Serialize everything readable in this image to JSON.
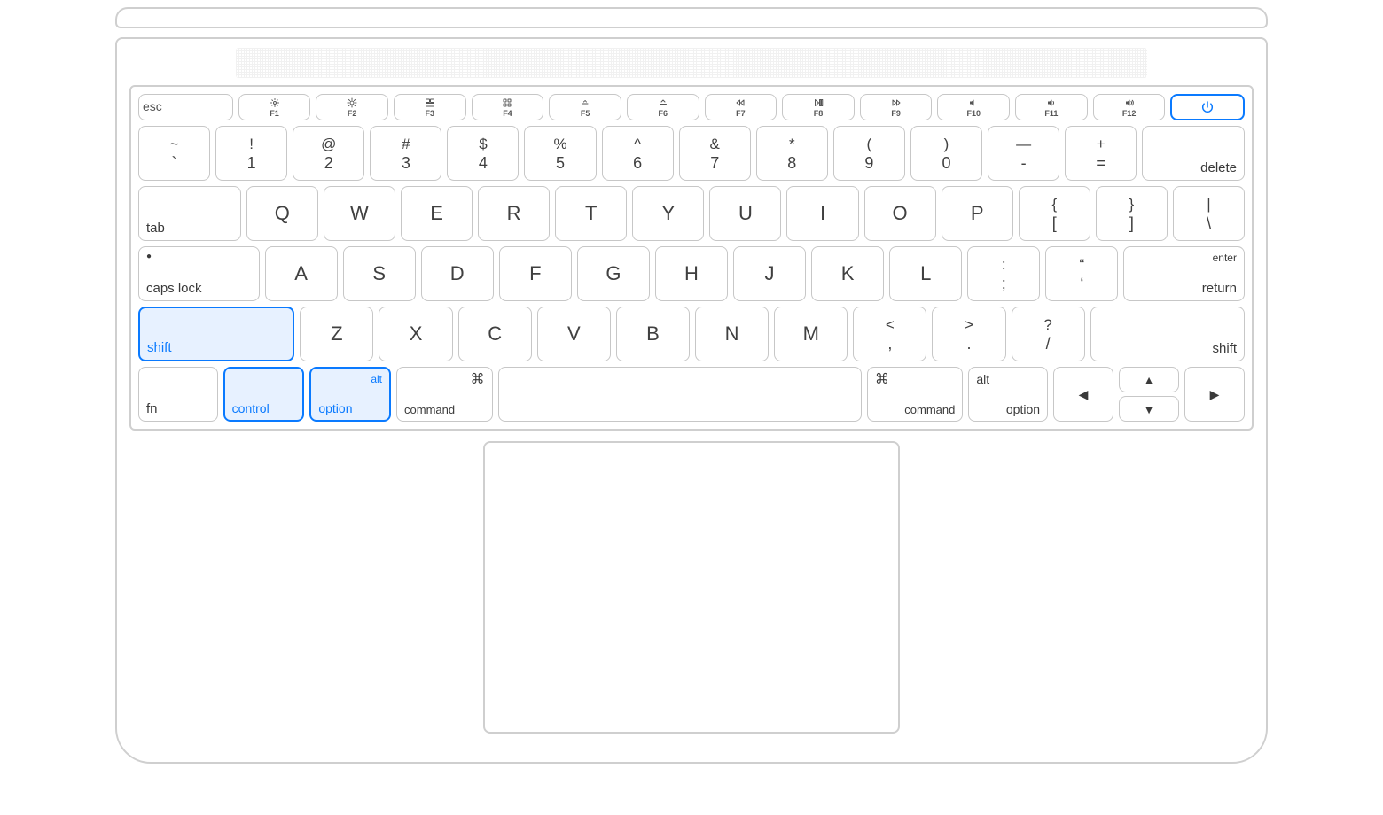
{
  "highlighted_keys": [
    "shift-left",
    "control-left",
    "option-left",
    "power"
  ],
  "function_row": {
    "esc": "esc",
    "keys": [
      {
        "id": "F1",
        "label": "F1",
        "icon": "brightness-down"
      },
      {
        "id": "F2",
        "label": "F2",
        "icon": "brightness-up"
      },
      {
        "id": "F3",
        "label": "F3",
        "icon": "mission-control"
      },
      {
        "id": "F4",
        "label": "F4",
        "icon": "launchpad"
      },
      {
        "id": "F5",
        "label": "F5",
        "icon": "keyboard-dim"
      },
      {
        "id": "F6",
        "label": "F6",
        "icon": "keyboard-bright"
      },
      {
        "id": "F7",
        "label": "F7",
        "icon": "rewind"
      },
      {
        "id": "F8",
        "label": "F8",
        "icon": "play-pause"
      },
      {
        "id": "F9",
        "label": "F9",
        "icon": "fast-forward"
      },
      {
        "id": "F10",
        "label": "F10",
        "icon": "mute"
      },
      {
        "id": "F11",
        "label": "F11",
        "icon": "volume-down"
      },
      {
        "id": "F12",
        "label": "F12",
        "icon": "volume-up"
      }
    ],
    "power_icon": "power"
  },
  "row1": {
    "keys": [
      {
        "upper": "~",
        "lower": "`"
      },
      {
        "upper": "!",
        "lower": "1"
      },
      {
        "upper": "@",
        "lower": "2"
      },
      {
        "upper": "#",
        "lower": "3"
      },
      {
        "upper": "$",
        "lower": "4"
      },
      {
        "upper": "%",
        "lower": "5"
      },
      {
        "upper": "^",
        "lower": "6"
      },
      {
        "upper": "&",
        "lower": "7"
      },
      {
        "upper": "*",
        "lower": "8"
      },
      {
        "upper": "(",
        "lower": "9"
      },
      {
        "upper": ")",
        "lower": "0"
      },
      {
        "upper": "—",
        "lower": "-"
      },
      {
        "upper": "+",
        "lower": "="
      }
    ],
    "delete": "delete"
  },
  "row2": {
    "tab": "tab",
    "letters": [
      "Q",
      "W",
      "E",
      "R",
      "T",
      "Y",
      "U",
      "I",
      "O",
      "P"
    ],
    "brackets": [
      {
        "upper": "{",
        "lower": "["
      },
      {
        "upper": "}",
        "lower": "]"
      },
      {
        "upper": "|",
        "lower": "\\"
      }
    ]
  },
  "row3": {
    "capslock": "caps lock",
    "letters": [
      "A",
      "S",
      "D",
      "F",
      "G",
      "H",
      "J",
      "K",
      "L"
    ],
    "punct": [
      {
        "upper": ":",
        "lower": ";"
      },
      {
        "upper": "“",
        "lower": "‘"
      }
    ],
    "return_top": "enter",
    "return_bottom": "return"
  },
  "row4": {
    "shift_l": "shift",
    "letters": [
      "Z",
      "X",
      "C",
      "V",
      "B",
      "N",
      "M"
    ],
    "punct": [
      {
        "upper": "<",
        "lower": ","
      },
      {
        "upper": ">",
        "lower": "."
      },
      {
        "upper": "?",
        "lower": "/"
      }
    ],
    "shift_r": "shift"
  },
  "row5": {
    "fn": "fn",
    "control": "control",
    "option_l": {
      "top": "alt",
      "bottom": "option"
    },
    "command_l": {
      "icon": "⌘",
      "label": "command"
    },
    "command_r": {
      "icon": "⌘",
      "label": "command"
    },
    "option_r": {
      "top": "alt",
      "bottom": "option"
    },
    "arrows": {
      "left": "◀",
      "up": "▲",
      "down": "▼",
      "right": "▶"
    }
  }
}
